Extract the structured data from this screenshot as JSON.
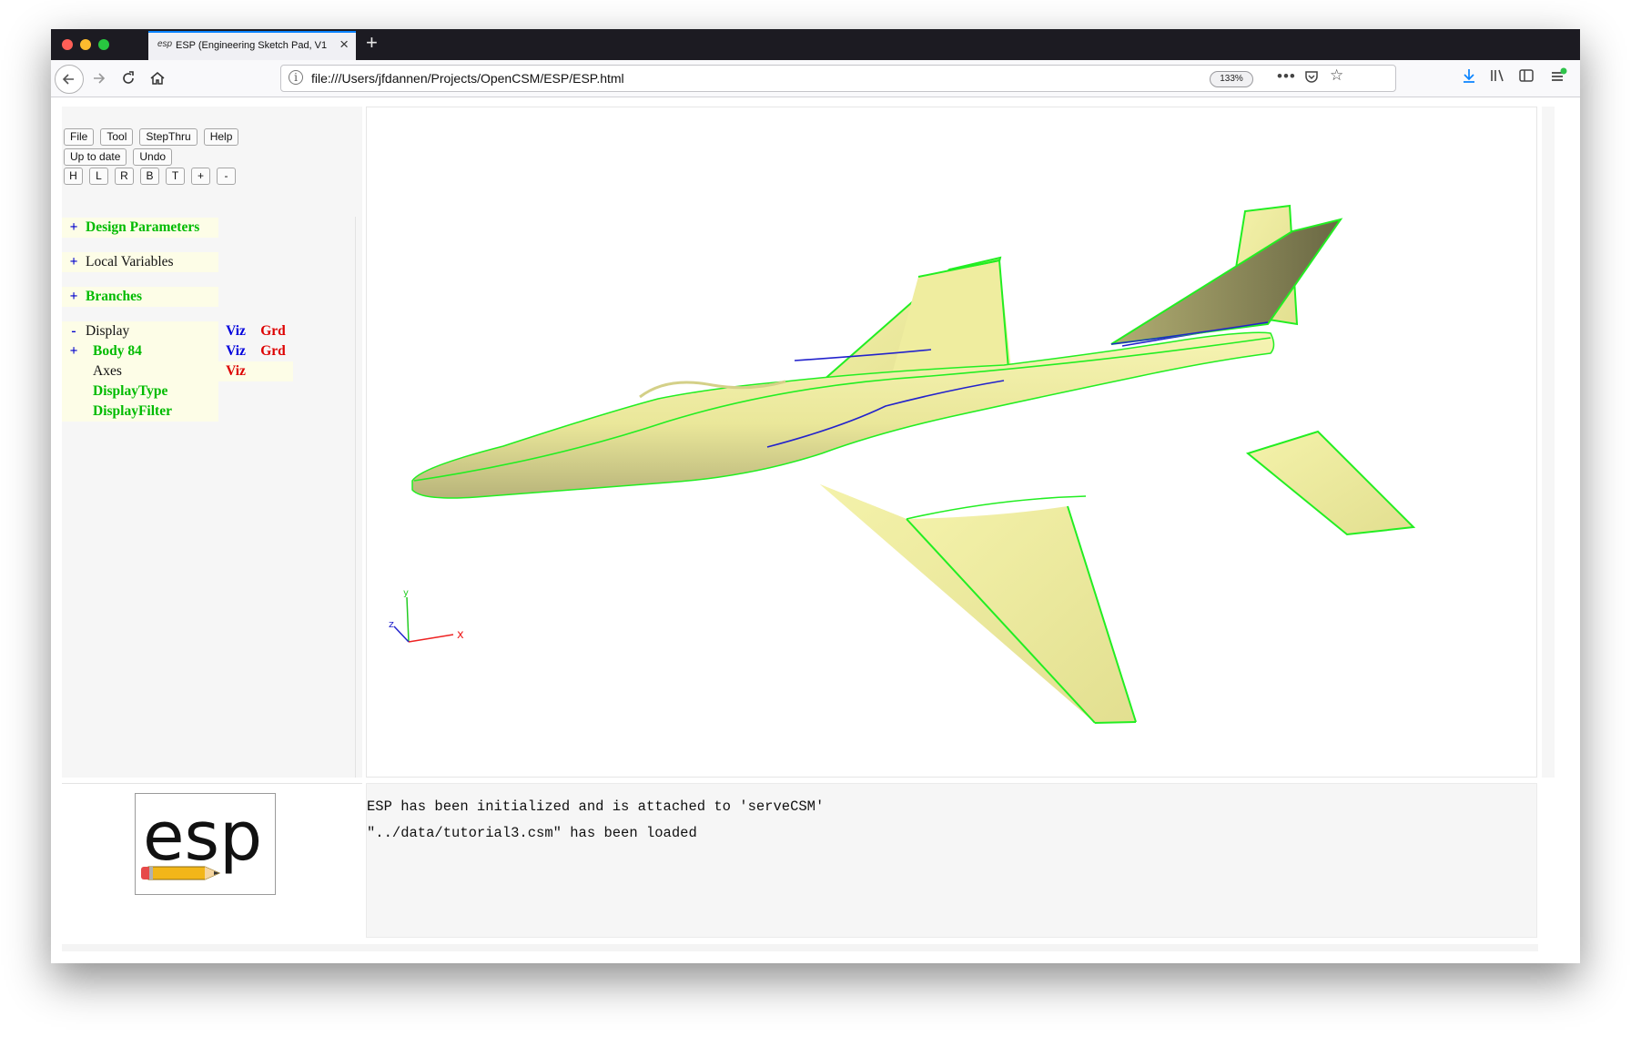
{
  "browser": {
    "tab_title": "ESP (Engineering Sketch Pad, V1",
    "tab_favicon": "esp",
    "new_tab_label": "+",
    "url": "file:///Users/jfdannen/Projects/OpenCSM/ESP/ESP.html",
    "zoom": "133%"
  },
  "toolbar": {
    "menu": [
      "File",
      "Tool",
      "StepThru",
      "Help"
    ],
    "actions": [
      "Up to date",
      "Undo"
    ],
    "views": [
      "H",
      "L",
      "R",
      "B",
      "T",
      "+",
      "-"
    ]
  },
  "tree": {
    "design_parameters": {
      "toggle": "+",
      "label": "Design Parameters"
    },
    "local_variables": {
      "toggle": "+",
      "label": "Local Variables"
    },
    "branches": {
      "toggle": "+",
      "label": "Branches"
    },
    "display": {
      "toggle": "-",
      "label": "Display",
      "viz": "Viz",
      "grd": "Grd"
    },
    "body": {
      "toggle": "+",
      "label": "Body 84",
      "viz": "Viz",
      "grd": "Grd"
    },
    "axes": {
      "label": "Axes",
      "viz": "Viz"
    },
    "display_type": {
      "label": "DisplayType"
    },
    "display_filter": {
      "label": "DisplayFilter"
    }
  },
  "logo": {
    "text": "esp"
  },
  "messages": [
    "ESP has been initialized and is attached to 'serveCSM'",
    "\"../data/tutorial3.csm\" has been loaded"
  ],
  "colors": {
    "surface": "#f0eea0",
    "edge_green": "#22ee22",
    "edge_blue": "#2222cc",
    "tree_green": "#00bb00",
    "viz_blue": "#0000dd",
    "grd_red": "#dd0000"
  }
}
